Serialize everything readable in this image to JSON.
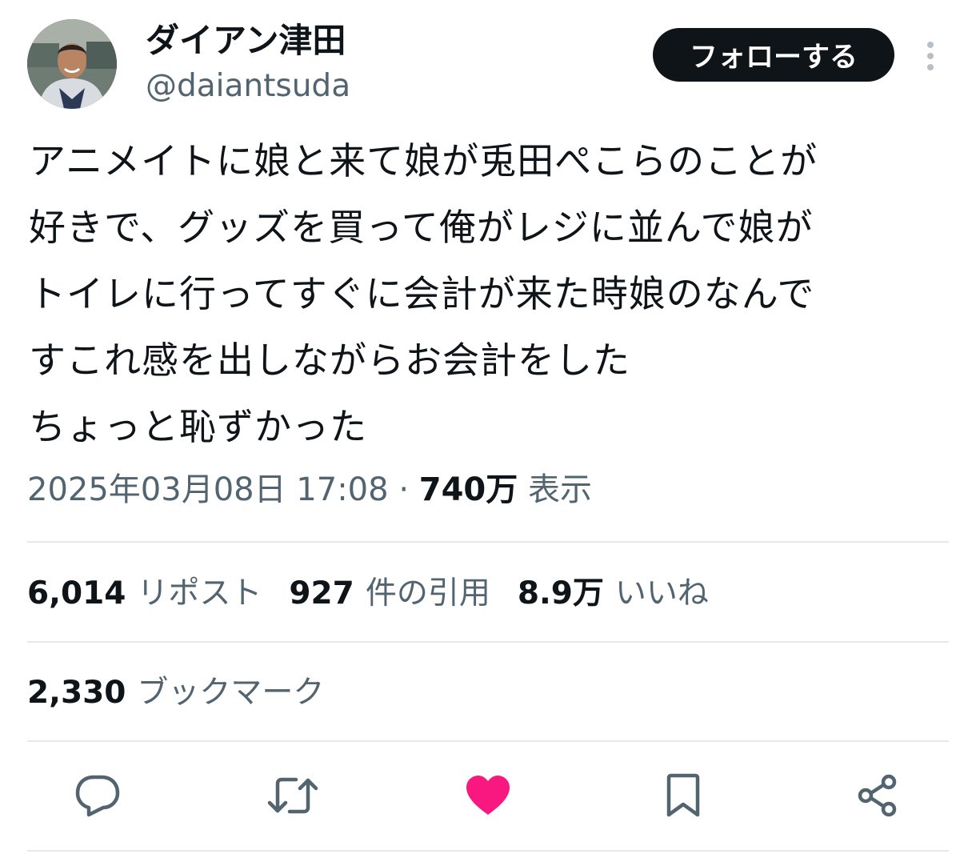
{
  "author": {
    "display_name": "ダイアン津田",
    "handle": "@daiantsuda"
  },
  "follow_button_label": "フォローする",
  "tweet": {
    "lines": [
      "アニメイトに娘と来て娘が兎田ぺこらのことが",
      "好きで、グッズを買って俺がレジに並んで娘が",
      "トイレに行ってすぐに会計が来た時娘のなんで",
      "すこれ感を出しながらお会計をした",
      "ちょっと恥ずかった"
    ],
    "timestamp": "2025年03月08日 17:08",
    "separator": "·",
    "views_count": "740万",
    "views_label": "表示"
  },
  "stats": {
    "reposts_count": "6,014",
    "reposts_label": "リポスト",
    "quotes_count": "927",
    "quotes_label": "件の引用",
    "likes_count": "8.9万",
    "likes_label": "いいね",
    "bookmarks_count": "2,330",
    "bookmarks_label": "ブックマーク"
  },
  "icons": {
    "reply": "reply-icon",
    "retweet": "retweet-icon",
    "like": "heart-icon",
    "bookmark": "bookmark-icon",
    "share": "share-icon"
  },
  "colors": {
    "text_primary": "#0f1419",
    "text_secondary": "#536471",
    "like_active": "#f91880",
    "divider": "#e6e9eb",
    "follow_button_bg": "#0f1419"
  }
}
